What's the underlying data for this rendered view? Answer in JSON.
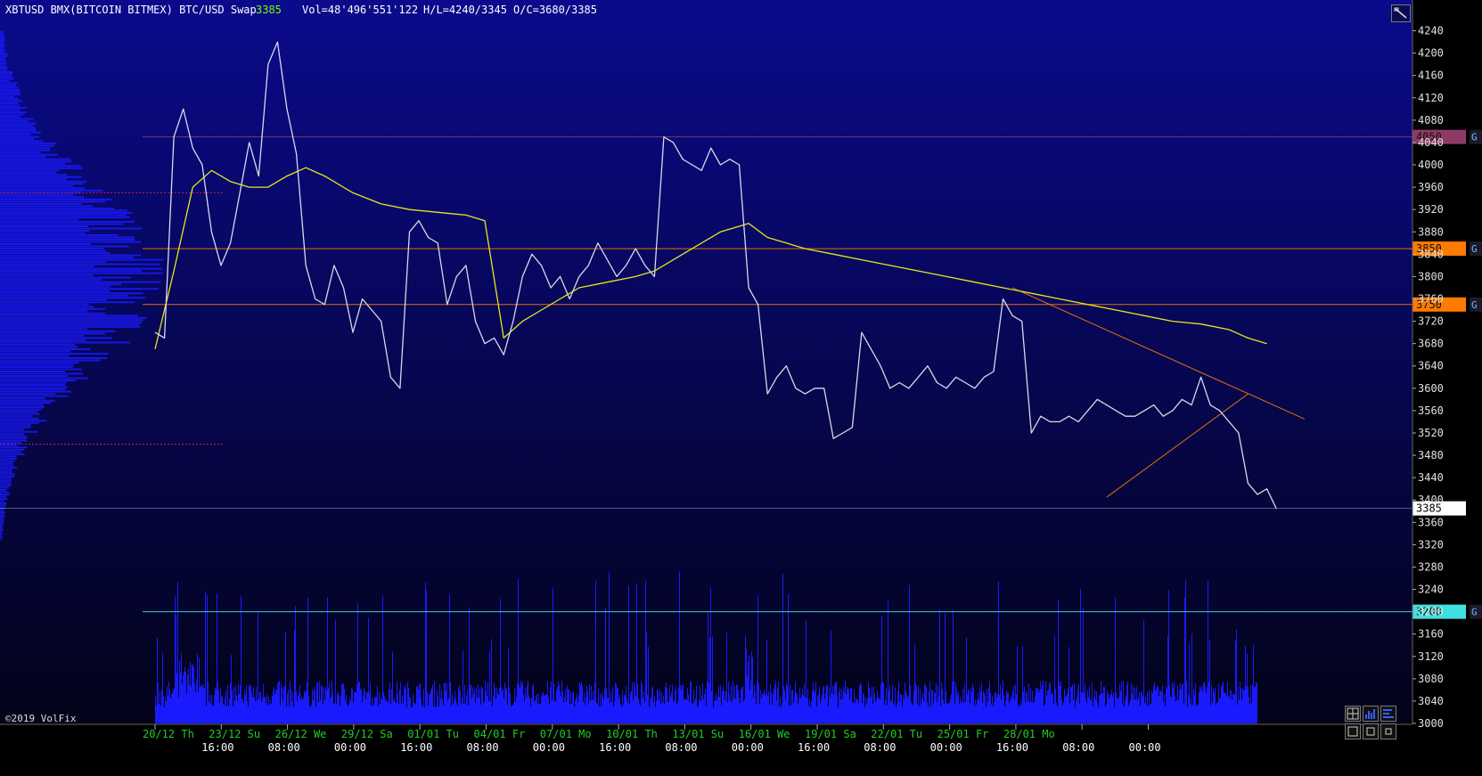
{
  "header": {
    "title": "XBTUSD BMX(BITCOIN BITMEX) BTC/USD Swap",
    "last": "3385",
    "volume": "Vol=48'496'551'122",
    "high_low": "H/L=4240/3345",
    "open_close": "O/C=3680/3385"
  },
  "footer": {
    "copyright": "©2019 VolFix"
  },
  "colors": {
    "background_top": "#0a0a8c",
    "background_bottom": "#03031a",
    "price": "#d8d8e8",
    "vwap": "#e6e61e",
    "level_purple": "#8e3a68",
    "level_orange": "#ff7a00",
    "level_cyan": "#40e0e0",
    "volume": "#1a1aff",
    "axis_date": "#22cc22"
  },
  "chart_data": {
    "type": "line",
    "title": "",
    "xlabel": "",
    "ylabel": "",
    "ylim": [
      3000,
      4260
    ],
    "y_ticks": [
      3000,
      3040,
      3080,
      3120,
      3160,
      3200,
      3240,
      3280,
      3320,
      3360,
      3400,
      3440,
      3480,
      3520,
      3560,
      3600,
      3640,
      3680,
      3720,
      3760,
      3800,
      3840,
      3880,
      3920,
      3960,
      4000,
      4040,
      4080,
      4120,
      4160,
      4200,
      4240
    ],
    "x_ticks": [
      {
        "date": "20/12 Th",
        "time": ""
      },
      {
        "date": "23/12 Su",
        "time": "16:00"
      },
      {
        "date": "26/12 We",
        "time": "08:00"
      },
      {
        "date": "29/12 Sa",
        "time": "00:00"
      },
      {
        "date": "01/01 Tu",
        "time": "16:00"
      },
      {
        "date": "04/01 Fr",
        "time": "08:00"
      },
      {
        "date": "07/01 Mo",
        "time": "00:00"
      },
      {
        "date": "10/01 Th",
        "time": "16:00"
      },
      {
        "date": "13/01 Su",
        "time": "08:00"
      },
      {
        "date": "16/01 We",
        "time": "00:00"
      },
      {
        "date": "19/01 Sa",
        "time": "16:00"
      },
      {
        "date": "22/01 Tu",
        "time": "08:00"
      },
      {
        "date": "25/01 Fr",
        "time": "00:00"
      },
      {
        "date": "28/01 Mo",
        "time": "16:00"
      },
      {
        "date": "",
        "time": "08:00"
      },
      {
        "date": "",
        "time": "00:00"
      }
    ],
    "price_levels": [
      {
        "value": 4050,
        "label": "4050",
        "color": "#8e3a68",
        "tag": "G"
      },
      {
        "value": 3850,
        "label": "3850",
        "color": "#ff7a00",
        "tag": "G"
      },
      {
        "value": 3750,
        "label": "3750",
        "color": "#ff7a00",
        "tag": "G"
      },
      {
        "value": 3385,
        "label": "3385",
        "color": "#ffffff",
        "tag": ""
      },
      {
        "value": 3200,
        "label": "3200",
        "color": "#40e0e0",
        "tag": "G"
      }
    ],
    "series": [
      {
        "name": "price",
        "x": [
          "20/12 00:00",
          "20/12 08:00",
          "20/12 16:00",
          "21/12 00:00",
          "21/12 08:00",
          "21/12 16:00",
          "22/12 00:00",
          "22/12 08:00",
          "22/12 16:00",
          "23/12 00:00",
          "23/12 08:00",
          "23/12 16:00",
          "24/12 00:00",
          "24/12 08:00",
          "24/12 16:00",
          "25/12 00:00",
          "25/12 08:00",
          "25/12 16:00",
          "26/12 00:00",
          "26/12 08:00",
          "26/12 16:00",
          "27/12 00:00",
          "27/12 08:00",
          "27/12 16:00",
          "28/12 00:00",
          "28/12 08:00",
          "28/12 16:00",
          "29/12 00:00",
          "29/12 08:00",
          "29/12 16:00",
          "30/12 00:00",
          "30/12 08:00",
          "30/12 16:00",
          "31/12 00:00",
          "31/12 08:00",
          "31/12 16:00",
          "01/01 00:00",
          "01/01 08:00",
          "01/01 16:00",
          "02/01 00:00",
          "02/01 08:00",
          "02/01 16:00",
          "03/01 00:00",
          "03/01 08:00",
          "03/01 16:00",
          "04/01 00:00",
          "04/01 08:00",
          "04/01 16:00",
          "05/01 00:00",
          "05/01 08:00",
          "05/01 16:00",
          "06/01 00:00",
          "06/01 08:00",
          "06/01 16:00",
          "07/01 00:00",
          "07/01 08:00",
          "07/01 16:00",
          "08/01 00:00",
          "08/01 08:00",
          "08/01 16:00",
          "09/01 00:00",
          "09/01 08:00",
          "09/01 16:00",
          "10/01 00:00",
          "10/01 08:00",
          "10/01 16:00",
          "11/01 00:00",
          "11/01 08:00",
          "11/01 16:00",
          "12/01 00:00",
          "12/01 08:00",
          "12/01 16:00",
          "13/01 00:00",
          "13/01 08:00",
          "13/01 16:00",
          "14/01 00:00",
          "14/01 08:00",
          "14/01 16:00",
          "15/01 00:00",
          "15/01 08:00",
          "15/01 16:00",
          "16/01 00:00",
          "16/01 08:00",
          "16/01 16:00",
          "17/01 00:00",
          "17/01 08:00",
          "17/01 16:00",
          "18/01 00:00",
          "18/01 08:00",
          "18/01 16:00",
          "19/01 00:00",
          "19/01 08:00",
          "19/01 16:00",
          "20/01 00:00",
          "20/01 08:00",
          "20/01 16:00",
          "21/01 00:00",
          "21/01 08:00",
          "21/01 16:00",
          "22/01 00:00",
          "22/01 08:00",
          "22/01 16:00",
          "23/01 00:00",
          "23/01 08:00",
          "23/01 16:00",
          "24/01 00:00",
          "24/01 08:00",
          "24/01 16:00",
          "25/01 00:00",
          "25/01 08:00",
          "25/01 16:00",
          "26/01 00:00",
          "26/01 08:00",
          "26/01 16:00",
          "27/01 00:00",
          "27/01 08:00",
          "27/01 16:00",
          "28/01 00:00",
          "28/01 08:00",
          "28/01 16:00"
        ],
        "values": [
          3700,
          3690,
          4050,
          4100,
          4030,
          4000,
          3880,
          3820,
          3860,
          3950,
          4040,
          3980,
          4180,
          4220,
          4100,
          4020,
          3820,
          3760,
          3750,
          3820,
          3780,
          3700,
          3760,
          3740,
          3720,
          3620,
          3600,
          3880,
          3900,
          3870,
          3860,
          3750,
          3800,
          3820,
          3720,
          3680,
          3690,
          3660,
          3720,
          3800,
          3840,
          3820,
          3780,
          3800,
          3760,
          3800,
          3820,
          3860,
          3830,
          3800,
          3820,
          3850,
          3820,
          3800,
          4050,
          4040,
          4010,
          4000,
          3990,
          4030,
          4000,
          4010,
          4000,
          3780,
          3750,
          3590,
          3620,
          3640,
          3600,
          3590,
          3600,
          3600,
          3510,
          3520,
          3530,
          3700,
          3670,
          3640,
          3600,
          3610,
          3600,
          3620,
          3640,
          3610,
          3600,
          3620,
          3610,
          3600,
          3620,
          3630,
          3760,
          3730,
          3720,
          3520,
          3550,
          3540,
          3540,
          3550,
          3540,
          3560,
          3580,
          3570,
          3560,
          3550,
          3550,
          3560,
          3570,
          3550,
          3560,
          3580,
          3570,
          3620,
          3570,
          3560,
          3540,
          3520,
          3430,
          3410,
          3420,
          3385
        ]
      },
      {
        "name": "vwap",
        "x": [
          "20/12 00:00",
          "20/12 16:00",
          "21/12 08:00",
          "22/12 00:00",
          "22/12 16:00",
          "23/12 08:00",
          "24/12 00:00",
          "24/12 16:00",
          "25/12 08:00",
          "26/12 00:00",
          "27/12 00:00",
          "28/12 00:00",
          "29/12 00:00",
          "30/12 00:00",
          "31/12 00:00",
          "31/12 08:00",
          "31/12 16:00",
          "01/01 08:00",
          "02/01 00:00",
          "02/01 16:00",
          "03/01 08:00",
          "04/01 00:00",
          "05/01 00:00",
          "06/01 00:00",
          "06/01 16:00",
          "07/01 00:00",
          "07/01 16:00",
          "08/01 08:00",
          "09/01 00:00",
          "09/01 16:00",
          "10/01 00:00",
          "10/01 16:00",
          "11/01 08:00",
          "12/01 00:00",
          "13/01 00:00",
          "14/01 00:00",
          "15/01 00:00",
          "16/01 00:00",
          "17/01 00:00",
          "18/01 00:00",
          "19/01 00:00",
          "20/01 00:00",
          "21/01 00:00",
          "22/01 00:00",
          "23/01 00:00",
          "24/01 00:00",
          "25/01 00:00",
          "26/01 00:00",
          "27/01 00:00",
          "27/01 16:00",
          "28/01 08:00"
        ],
        "values": [
          3670,
          3810,
          3960,
          3990,
          3970,
          3960,
          3960,
          3980,
          3995,
          3980,
          3950,
          3930,
          3920,
          3915,
          3910,
          3905,
          3900,
          3690,
          3720,
          3740,
          3760,
          3780,
          3790,
          3800,
          3810,
          3820,
          3840,
          3860,
          3880,
          3890,
          3895,
          3870,
          3860,
          3850,
          3840,
          3830,
          3820,
          3810,
          3800,
          3790,
          3780,
          3770,
          3760,
          3750,
          3740,
          3730,
          3720,
          3715,
          3705,
          3690,
          3680
        ]
      }
    ],
    "trendlines": [
      {
        "name": "resistance",
        "from": {
          "x": "19/01 08:00",
          "y": 3780
        },
        "to": {
          "x": "29/01 16:00",
          "y": 3545
        },
        "color": "#ff7a00"
      },
      {
        "name": "support",
        "from": {
          "x": "22/01 16:00",
          "y": 3405
        },
        "to": {
          "x": "27/01 16:00",
          "y": 3590
        },
        "color": "#ff7a00"
      }
    ]
  }
}
